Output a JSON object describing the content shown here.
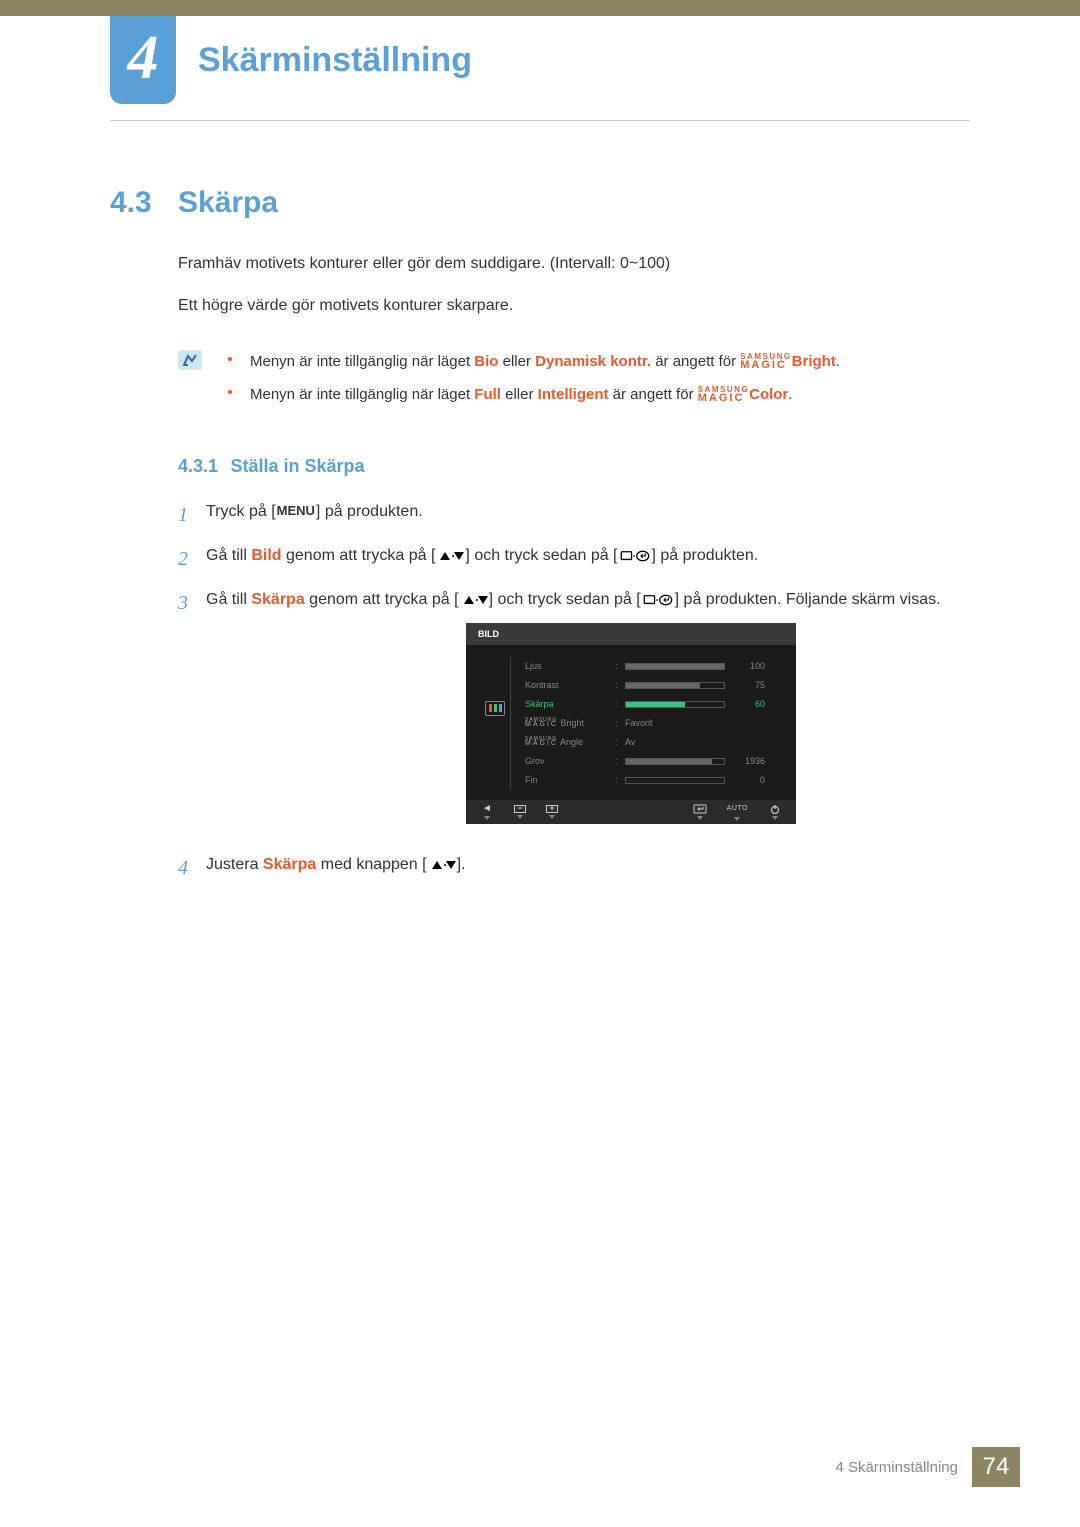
{
  "chapter": {
    "number": "4",
    "title": "Skärminställning"
  },
  "section": {
    "number": "4.3",
    "title": "Skärpa"
  },
  "intro1": "Framhäv motivets konturer eller gör dem suddigare. (Intervall: 0~100)",
  "intro2": "Ett högre värde gör motivets konturer skarpare.",
  "note": {
    "l1a": "Menyn är inte tillgänglig när läget ",
    "l1b": "Bio",
    "l1c": " eller ",
    "l1d": "Dynamisk kontr.",
    "l1e": " är angett för ",
    "l1_magic_top": "SAMSUNG",
    "l1_magic_bot": "MAGIC",
    "l1f": "Bright",
    "l1g": ".",
    "l2a": "Menyn är inte tillgänglig när läget ",
    "l2b": "Full",
    "l2c": " eller ",
    "l2d": "Intelligent",
    "l2e": " är angett för ",
    "l2f": "Color",
    "l2g": "."
  },
  "subsection": {
    "number": "4.3.1",
    "title": "Ställa in Skärpa"
  },
  "steps": {
    "s1a": "Tryck på [",
    "s1_menu": "MENU",
    "s1b": "] på produkten.",
    "s2a": "Gå till ",
    "s2_bild": "Bild",
    "s2b": " genom att trycka på [",
    "s2c": "] och tryck sedan på [",
    "s2d": "] på produkten.",
    "s3a": "Gå till ",
    "s3_skarpa": "Skärpa",
    "s3b": " genom att trycka på [",
    "s3c": "] och tryck sedan på [",
    "s3d": "] på produkten. Följande skärm visas.",
    "s4a": "Justera ",
    "s4_skarpa": "Skärpa",
    "s4b": " med knappen [",
    "s4c": "]."
  },
  "osd": {
    "title": "BILD",
    "rows": [
      {
        "label": "Ljus",
        "type": "bar",
        "value": 100,
        "max": 100
      },
      {
        "label": "Kontrast",
        "type": "bar",
        "value": 75,
        "max": 100
      },
      {
        "label": "Skärpa",
        "type": "bar",
        "value": 60,
        "max": 100,
        "active": true
      },
      {
        "label": "Bright",
        "type": "magic",
        "text": "Favorit"
      },
      {
        "label": "Angle",
        "type": "magic",
        "text": "Av"
      },
      {
        "label": "Grov",
        "type": "bar",
        "value": 1936,
        "max": 2200,
        "wide": true
      },
      {
        "label": "Fin",
        "type": "bar",
        "value": 0,
        "max": 100
      }
    ],
    "auto": "AUTO",
    "magic_small": "SAMSUNG",
    "magic_big": "MAGIC"
  },
  "footer": {
    "text": "4 Skärminställning",
    "page": "74"
  }
}
